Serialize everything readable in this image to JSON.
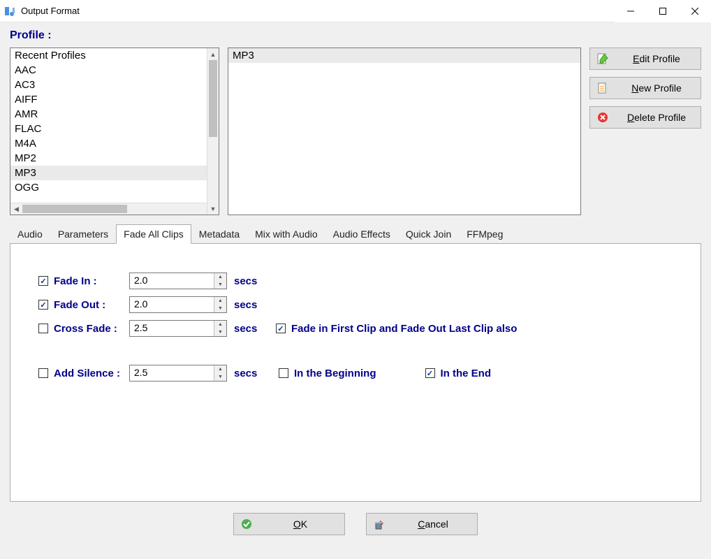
{
  "window": {
    "title": "Output Format"
  },
  "profile_label": "Profile :",
  "categories": {
    "items": [
      "Recent Profiles",
      "AAC",
      "AC3",
      "AIFF",
      "AMR",
      "FLAC",
      "M4A",
      "MP2",
      "MP3",
      "OGG"
    ],
    "selected_index": 8
  },
  "profile_detail": {
    "selected": "MP3"
  },
  "side_buttons": {
    "edit": {
      "prefix": "",
      "accel": "E",
      "suffix": "dit Profile"
    },
    "new": {
      "prefix": "",
      "accel": "N",
      "suffix": "ew Profile"
    },
    "delete": {
      "prefix": "",
      "accel": "D",
      "suffix": "elete Profile"
    }
  },
  "tabs": [
    "Audio",
    "Parameters",
    "Fade All Clips",
    "Metadata",
    "Mix with Audio",
    "Audio Effects",
    "Quick Join",
    "FFMpeg"
  ],
  "active_tab_index": 2,
  "fade": {
    "fade_in": {
      "checked": true,
      "label": "Fade In :",
      "value": "2.0",
      "unit": "secs"
    },
    "fade_out": {
      "checked": true,
      "label": "Fade Out :",
      "value": "2.0",
      "unit": "secs"
    },
    "cross": {
      "checked": false,
      "label": "Cross Fade :",
      "value": "2.5",
      "unit": "secs"
    },
    "cross_opt": {
      "checked": true,
      "label": "Fade in First Clip and Fade Out Last Clip also"
    },
    "silence": {
      "checked": false,
      "label": "Add Silence :",
      "value": "2.5",
      "unit": "secs"
    },
    "sil_begin": {
      "checked": false,
      "label": "In the Beginning"
    },
    "sil_end": {
      "checked": true,
      "label": "In the End"
    }
  },
  "dialog": {
    "ok": {
      "accel": "O",
      "suffix": "K"
    },
    "cancel": {
      "accel": "C",
      "suffix": "ancel"
    }
  }
}
